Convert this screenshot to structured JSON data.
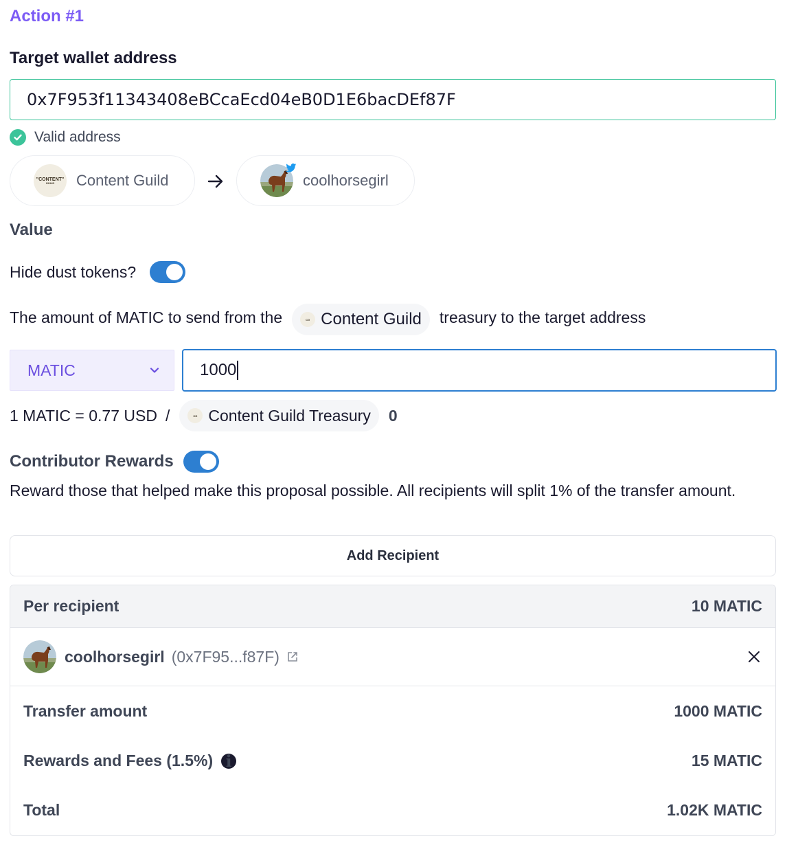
{
  "action_title": "Action #1",
  "target": {
    "label": "Target wallet address",
    "address": "0x7F953f11343408eBCcaEcd04eB0D1E6bacDEf87F",
    "valid_text": "Valid address",
    "from_name": "Content Guild",
    "from_logo_text": "\"CONTENT\"",
    "from_logo_sub": "GUILD",
    "to_name": "coolhorsegirl"
  },
  "value": {
    "label": "Value",
    "hide_dust_label": "Hide dust tokens?",
    "description_pre": "The amount of MATIC to send from the",
    "treasury_chip": "Content Guild",
    "description_post": "treasury to the target address",
    "token": "MATIC",
    "amount": "1000",
    "rate": "1 MATIC = 0.77 USD",
    "separator": "/",
    "treasury_name": "Content Guild Treasury",
    "treasury_balance": "0"
  },
  "rewards": {
    "label": "Contributor Rewards",
    "description": "Reward those that helped make this proposal possible. All recipients will split 1% of the transfer amount.",
    "add_button": "Add Recipient",
    "per_recipient_label": "Per recipient",
    "per_recipient_value": "10 MATIC",
    "recipient_name": "coolhorsegirl",
    "recipient_address": "(0x7F95...f87F)"
  },
  "summary": {
    "transfer_label": "Transfer amount",
    "transfer_value": "1000 MATIC",
    "fees_label": "Rewards and Fees (1.5%)",
    "fees_value": "15 MATIC",
    "total_label": "Total",
    "total_value": "1.02K MATIC"
  },
  "colors": {
    "accent": "#7c5cf5",
    "valid": "#3cc49a",
    "toggle": "#2d7fd1"
  },
  "icons": [
    "check-circle-icon",
    "arrow-right-icon",
    "twitter-icon",
    "chevron-down-icon",
    "external-link-icon",
    "close-icon",
    "info-icon"
  ]
}
